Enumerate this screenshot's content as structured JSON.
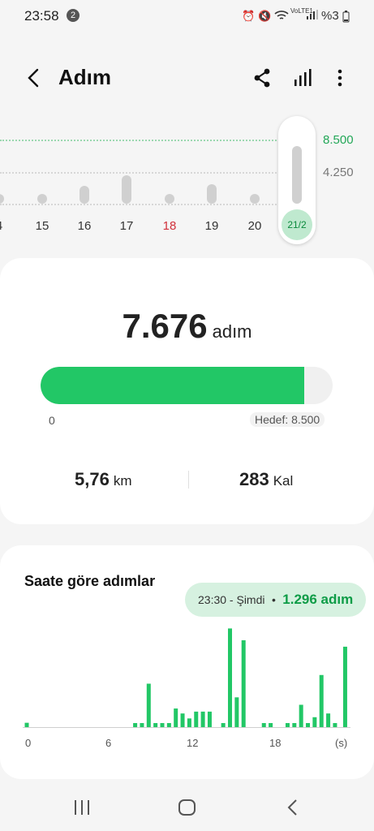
{
  "status_bar": {
    "time": "23:58",
    "notification_count": "2",
    "network_label": "VoLTE1",
    "battery": "%3"
  },
  "header": {
    "title": "Adım",
    "icons": [
      "back-icon",
      "share-icon",
      "bar-chart-icon",
      "more-vertical-icon"
    ]
  },
  "week_chart": {
    "y_labels": [
      "8.500",
      "4.250"
    ],
    "goal_color": "#22c766",
    "days": [
      "4",
      "15",
      "16",
      "17",
      "18",
      "19",
      "20"
    ],
    "values": [
      1200,
      900,
      2400,
      3800,
      1000,
      2600,
      900
    ],
    "selected_label": "21/2",
    "selected_value": 7676,
    "highlight_day_color": "#d0303a"
  },
  "summary": {
    "steps": "7.676",
    "steps_unit": "adım",
    "progress": 0.903,
    "progress_start": "0",
    "goal_label": "Hedef: 8.500",
    "distance_value": "5,76",
    "distance_unit": "km",
    "calories_value": "283",
    "calories_unit": "Kal",
    "accent": "#22c766"
  },
  "hourly": {
    "title": "Saate göre adımlar",
    "tooltip_time": "23:30 - Şimdi",
    "tooltip_sep": "•",
    "tooltip_value": "1.296 adım",
    "x_ticks": [
      "0",
      "6",
      "12",
      "18",
      "(s)"
    ]
  },
  "chart_data": {
    "type": "bar",
    "title": "Saate göre adımlar",
    "xlabel": "(s)",
    "x": [
      0,
      8,
      8.5,
      9,
      9.5,
      10,
      10.5,
      11,
      11.5,
      12,
      12.5,
      13,
      13.5,
      14.5,
      15,
      15.5,
      16,
      17.5,
      18,
      19.25,
      19.75,
      20.25,
      20.75,
      21.25,
      21.75,
      22.25,
      22.75,
      23.5
    ],
    "values": [
      70,
      60,
      60,
      700,
      60,
      60,
      60,
      300,
      220,
      140,
      250,
      250,
      250,
      60,
      1590,
      480,
      1400,
      60,
      60,
      60,
      60,
      360,
      60,
      160,
      840,
      220,
      40,
      1296
    ],
    "ylim": [
      0,
      1700
    ],
    "color": "#22c766"
  },
  "nav_bar": {
    "icons": [
      "recent-apps-icon",
      "home-icon",
      "back-nav-icon"
    ]
  }
}
